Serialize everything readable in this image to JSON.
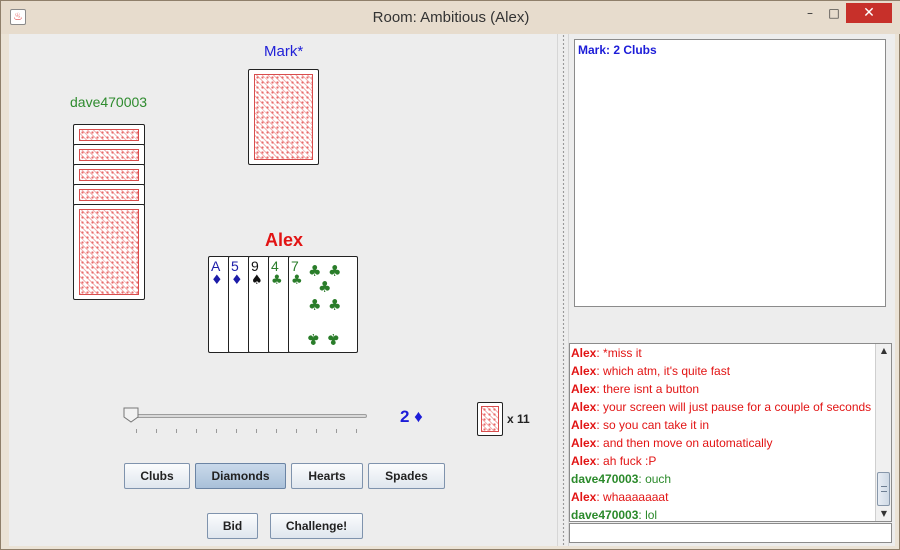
{
  "window": {
    "title": "Room: Ambitious (Alex)",
    "icon": "java-icon",
    "controls": {
      "minimize": "–",
      "maximize": "□",
      "close": "✕"
    }
  },
  "players": {
    "top": {
      "name": "Mark*",
      "color": "#2121d8",
      "cards_shown": 1
    },
    "left": {
      "name": "dave470003",
      "color": "#2e8b2e",
      "cards_shown": 5
    },
    "self": {
      "name": "Alex",
      "color": "#e21414"
    }
  },
  "hand": [
    {
      "rank": "A",
      "suit": "♦",
      "color": "#1c1ca8"
    },
    {
      "rank": "5",
      "suit": "♦",
      "color": "#1c1ca8"
    },
    {
      "rank": "9",
      "suit": "♠",
      "color": "#111111"
    },
    {
      "rank": "4",
      "suit": "♣",
      "color": "#2a7d2a"
    },
    {
      "rank": "7",
      "suit": "♣",
      "color": "#2a7d2a"
    }
  ],
  "bid": {
    "slider_value": 0,
    "display": "2 ♦"
  },
  "deck": {
    "count_label": "x 11"
  },
  "suit_buttons": [
    {
      "label": "Clubs",
      "selected": false
    },
    {
      "label": "Diamonds",
      "selected": true
    },
    {
      "label": "Hearts",
      "selected": false
    },
    {
      "label": "Spades",
      "selected": false
    }
  ],
  "actions": {
    "bid": "Bid",
    "challenge": "Challenge!"
  },
  "game_log": {
    "line": "Mark: 2 Clubs"
  },
  "chat": [
    {
      "who": "Alex",
      "text": ": *miss it",
      "team": "alex"
    },
    {
      "who": "Alex",
      "text": ": which atm, it's quite fast",
      "team": "alex"
    },
    {
      "who": "Alex",
      "text": ": there isnt a button",
      "team": "alex"
    },
    {
      "who": "Alex",
      "text": ": your screen will just pause for a couple of seconds",
      "team": "alex"
    },
    {
      "who": "Alex",
      "text": ": so you can take it in",
      "team": "alex"
    },
    {
      "who": "Alex",
      "text": ": and then move on automatically",
      "team": "alex"
    },
    {
      "who": "Alex",
      "text": ": ah fuck :P",
      "team": "alex"
    },
    {
      "who": "dave470003",
      "text": ": ouch",
      "team": "dave"
    },
    {
      "who": "Alex",
      "text": ": whaaaaaaat",
      "team": "alex"
    },
    {
      "who": "dave470003",
      "text": ": lol",
      "team": "dave"
    }
  ]
}
